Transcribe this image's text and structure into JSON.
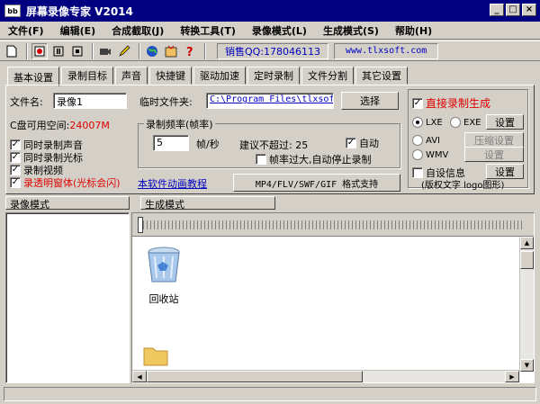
{
  "window": {
    "title": "屏幕录像专家 V2014",
    "app_icon_text": "bb",
    "minimize": "_",
    "maximize": "□",
    "close": "×"
  },
  "menu": [
    "文件(F)",
    "编辑(E)",
    "合成截取(J)",
    "转换工具(T)",
    "录像模式(L)",
    "生成模式(S)",
    "帮助(H)"
  ],
  "toolbar": {
    "qq": "销售QQ:178046113",
    "site": "www.tlxsoft.com"
  },
  "tabs": [
    "基本设置",
    "录制目标",
    "声音",
    "快捷键",
    "驱动加速",
    "定时录制",
    "文件分割",
    "其它设置"
  ],
  "basic": {
    "filename_label": "文件名:",
    "filename_value": "录像1",
    "tempdir_label": "临时文件夹:",
    "tempdir_value": "C:\\Program Files\\tlxsof",
    "select_button": "选择",
    "disk_label": "C盘可用空间:",
    "disk_value": "24007M",
    "rate_group": "录制频率(帧率)",
    "fps_value": "5",
    "fps_unit": "帧/秒",
    "suggest": "建议不超过: 25",
    "auto_label": "自动",
    "auto_checked": true,
    "stop_label": "帧率过大,自动停止录制",
    "stop_checked": false,
    "rec_sound": "同时录制声音",
    "rec_sound_checked": true,
    "rec_cursor": "同时录制光标",
    "rec_cursor_checked": true,
    "rec_video": "录制视频",
    "rec_video_checked": true,
    "rec_transparent": "录透明窗体(光标会闪)",
    "rec_transparent_checked": true,
    "tutorial_link": "本软件动画教程",
    "format_button": "MP4/FLV/SWF/GIF  格式支持"
  },
  "direct": {
    "title": "直接录制生成",
    "checked": true,
    "lxe": "LXE",
    "exe": "EXE",
    "avi": "AVI",
    "wmv": "WMV",
    "settings1": "设置",
    "compress": "压缩设置",
    "settings2": "设置",
    "self_info": "自设信息",
    "self_info_checked": false,
    "settings3": "设置",
    "copyright": "(版权文字 logo图形)"
  },
  "modes": {
    "record_mode": "录像模式",
    "generate_mode": "生成模式"
  },
  "desktop": {
    "recycle_bin": "回收站"
  },
  "colors": {
    "title_bg": "#000080",
    "accent_red": "#e00000",
    "link_blue": "#0000c0"
  }
}
